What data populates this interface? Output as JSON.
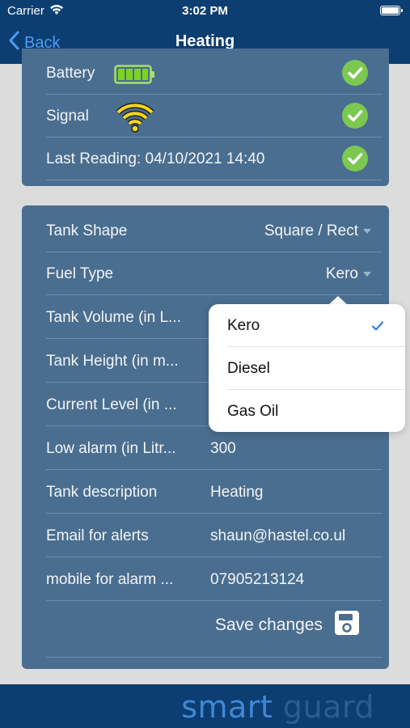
{
  "status_bar": {
    "carrier": "Carrier",
    "time": "3:02 PM"
  },
  "nav": {
    "back_label": "Back",
    "title": "Heating"
  },
  "status_card": {
    "battery_label": "Battery",
    "signal_label": "Signal",
    "last_reading_label": "Last Reading: 04/10/2021 14:40"
  },
  "settings": {
    "tank_shape": {
      "label": "Tank Shape",
      "value": "Square / Rect"
    },
    "fuel_type": {
      "label": "Fuel Type",
      "value": "Kero"
    },
    "tank_volume": {
      "label": "Tank Volume (in L..."
    },
    "tank_height": {
      "label": "Tank Height (in m..."
    },
    "current_level": {
      "label": "Current Level (in ..."
    },
    "low_alarm": {
      "label": "Low alarm (in Litr...",
      "value": "300"
    },
    "tank_description": {
      "label": "Tank description",
      "value": "Heating"
    },
    "email_alerts": {
      "label": "Email for alerts",
      "value": "shaun@hastel.co.ul"
    },
    "mobile_alarm": {
      "label": "mobile for alarm ...",
      "value": "07905213124"
    },
    "save_label": "Save changes"
  },
  "fuel_dropdown": {
    "options": [
      "Kero",
      "Diesel",
      "Gas Oil"
    ],
    "selected": "Kero"
  },
  "footer": {
    "logo_part1": "smart",
    "logo_part2": "guard"
  },
  "colors": {
    "header_bg": "#0d3e72",
    "card_bg": "#4a6e8f",
    "accent": "#4f9bf0",
    "check_green": "#7cc850"
  }
}
